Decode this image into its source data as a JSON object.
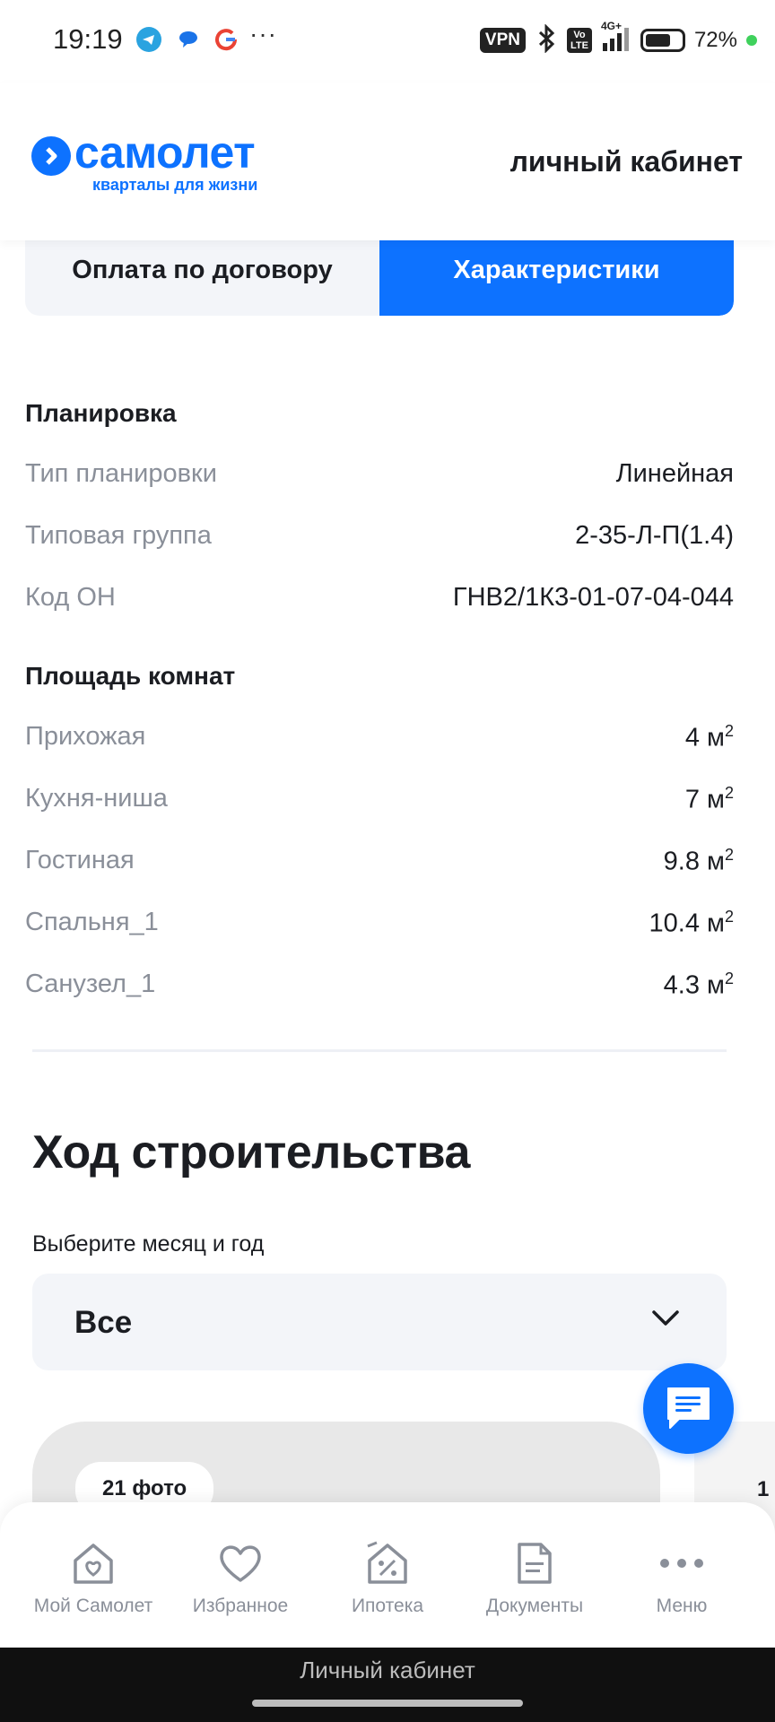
{
  "status_bar": {
    "time": "19:19",
    "dots": "···",
    "vpn": "VPN",
    "volte": "Vo\nLTE",
    "network": "4G+",
    "battery_percent": "72%",
    "battery_level": 0.72,
    "icons": [
      "telegram-icon",
      "messages-icon",
      "google-icon",
      "bluetooth-icon",
      "signal-icon",
      "battery-icon"
    ]
  },
  "header": {
    "logo_title": "самолет",
    "logo_subtitle": "кварталы для жизни",
    "account_link": "личный кабинет",
    "brand_color": "#0d72ff"
  },
  "tabs": [
    {
      "label": "Оплата по договору",
      "active": false
    },
    {
      "label": "Характеристики",
      "active": true
    }
  ],
  "layout_section": {
    "title": "Планировка",
    "rows": [
      {
        "key": "Тип планировки",
        "value": "Линейная"
      },
      {
        "key": "Типовая группа",
        "value": "2-35-Л-П(1.4)"
      },
      {
        "key": "Код ОН",
        "value": "ГНВ2/1К3-01-07-04-044"
      }
    ]
  },
  "rooms_section": {
    "title": "Площадь комнат",
    "unit": "м",
    "unit_sup": "2",
    "rows": [
      {
        "key": "Прихожая",
        "value": "4"
      },
      {
        "key": "Кухня-ниша",
        "value": "7"
      },
      {
        "key": "Гостиная",
        "value": "9.8"
      },
      {
        "key": "Спальня_1",
        "value": "10.4"
      },
      {
        "key": "Санузел_1",
        "value": "4.3"
      }
    ]
  },
  "construction": {
    "title": "Ход строительства",
    "select_label": "Выберите месяц и год",
    "select_value": "Все",
    "photo_badge": "21 фото",
    "next_card_text": "1"
  },
  "bottom_nav": [
    {
      "label": "Мой Самолет",
      "icon": "home-heart-icon"
    },
    {
      "label": "Избранное",
      "icon": "heart-icon"
    },
    {
      "label": "Ипотека",
      "icon": "mortgage-icon"
    },
    {
      "label": "Документы",
      "icon": "document-icon"
    },
    {
      "label": "Меню",
      "icon": "more-icon"
    }
  ],
  "system_bar": {
    "title": "Личный кабинет"
  }
}
